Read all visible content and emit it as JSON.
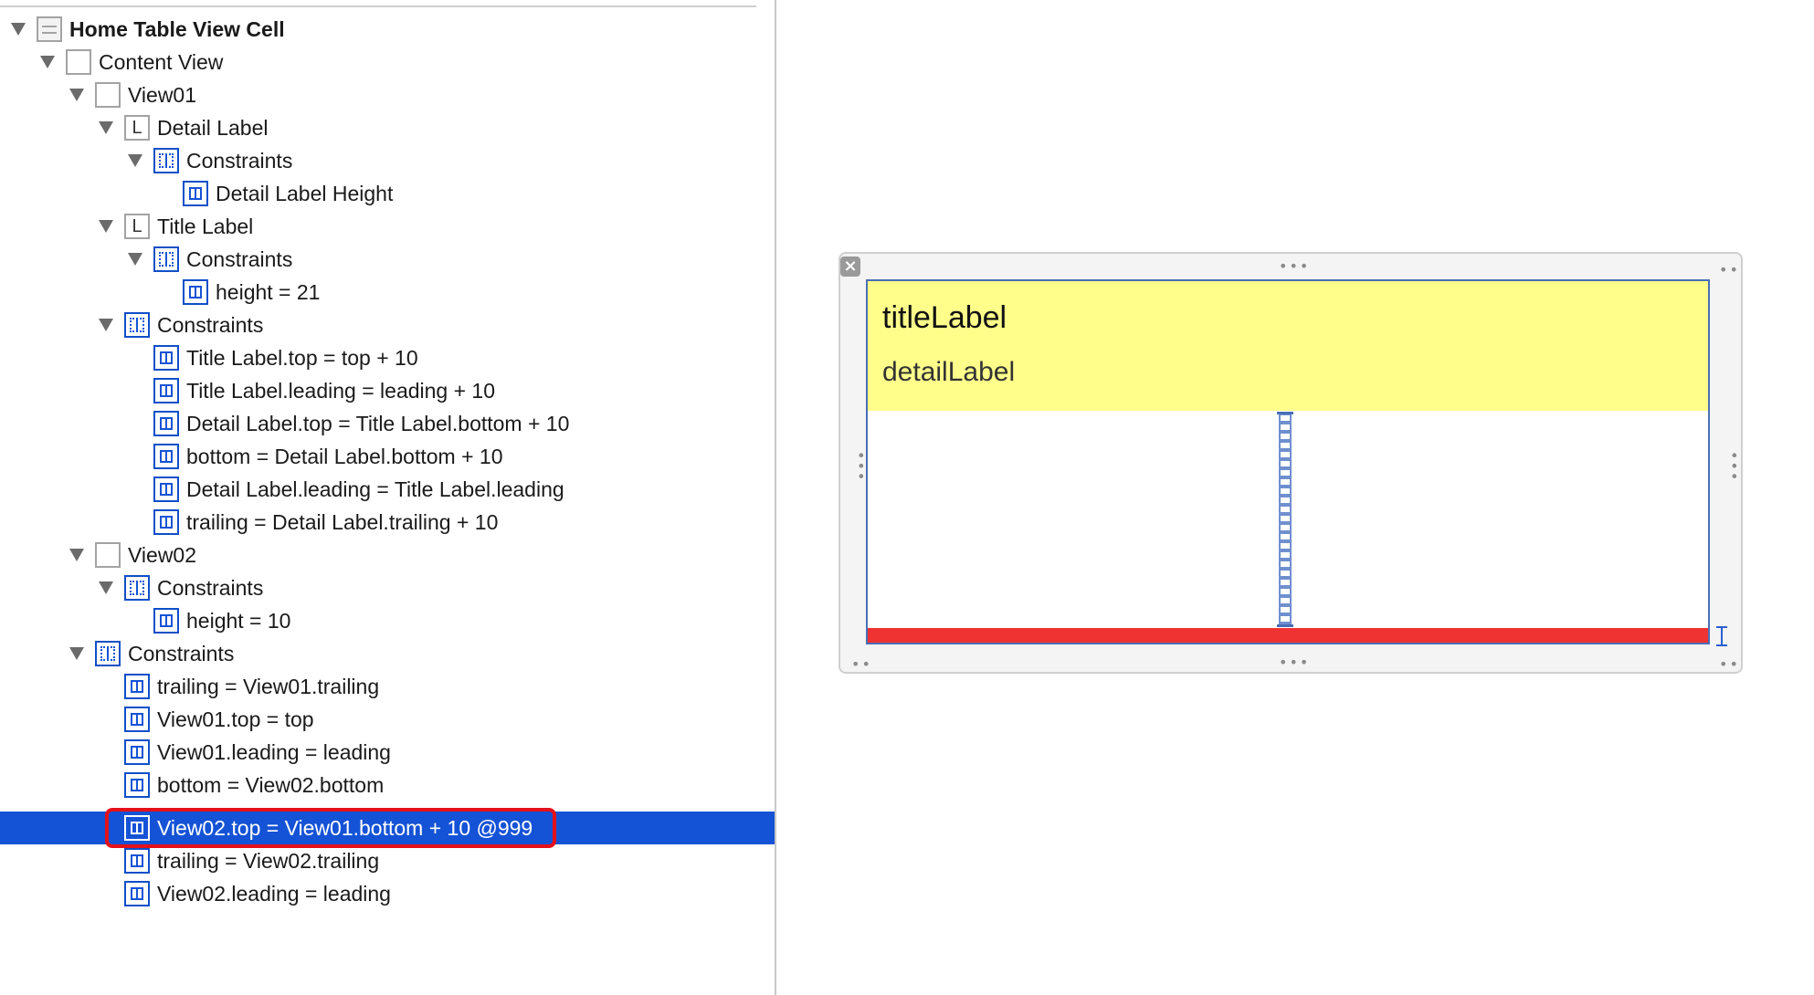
{
  "outline": {
    "rows": [
      {
        "label": "Home Table View Cell",
        "icon": "cell-icon"
      },
      {
        "label": "Content View",
        "icon": "view-icon"
      },
      {
        "label": "View01",
        "icon": "view-icon"
      },
      {
        "label": "Detail Label",
        "icon": "label-icon",
        "icon_glyph": "L"
      },
      {
        "label": "Constraints",
        "icon": "constraints-group-icon"
      },
      {
        "label": "Detail Label Height",
        "icon": "height-constraint-icon"
      },
      {
        "label": "Title Label",
        "icon": "label-icon",
        "icon_glyph": "L"
      },
      {
        "label": "Constraints",
        "icon": "constraints-group-icon"
      },
      {
        "label": "height = 21",
        "icon": "height-constraint-icon"
      },
      {
        "label": "Constraints",
        "icon": "constraints-group-icon"
      },
      {
        "label": "Title Label.top = top + 10",
        "icon": "top-constraint-icon"
      },
      {
        "label": "Title Label.leading = leading + 10",
        "icon": "leading-constraint-icon"
      },
      {
        "label": "Detail Label.top = Title Label.bottom + 10",
        "icon": "vertical-spacing-constraint-icon"
      },
      {
        "label": "bottom = Detail Label.bottom + 10",
        "icon": "bottom-constraint-icon"
      },
      {
        "label": "Detail Label.leading = Title Label.leading",
        "icon": "leading-align-constraint-icon"
      },
      {
        "label": "trailing = Detail Label.trailing + 10",
        "icon": "trailing-constraint-icon"
      },
      {
        "label": "View02",
        "icon": "view-icon"
      },
      {
        "label": "Constraints",
        "icon": "constraints-group-icon"
      },
      {
        "label": "height = 10",
        "icon": "height-constraint-icon"
      },
      {
        "label": "Constraints",
        "icon": "constraints-group-icon"
      },
      {
        "label": "trailing = View01.trailing",
        "icon": "trailing-constraint-icon"
      },
      {
        "label": "View01.top = top",
        "icon": "top-constraint-icon"
      },
      {
        "label": "View01.leading = leading",
        "icon": "leading-constraint-icon"
      },
      {
        "label": "bottom = View02.bottom",
        "icon": "bottom-constraint-icon"
      },
      {
        "label": "View02.top = View01.bottom + 10 @999",
        "icon": "vertical-spacing-constraint-icon",
        "selected": true
      },
      {
        "label": "trailing = View02.trailing",
        "icon": "trailing-constraint-icon"
      },
      {
        "label": "View02.leading = leading",
        "icon": "leading-constraint-icon"
      }
    ]
  },
  "canvas": {
    "title_label_text": "titleLabel",
    "detail_label_text": "detailLabel",
    "view01_color": "#fffe8b",
    "view02_color": "#ef3232",
    "selection_color": "#1553d6",
    "highlight_color": "#e4111a"
  }
}
